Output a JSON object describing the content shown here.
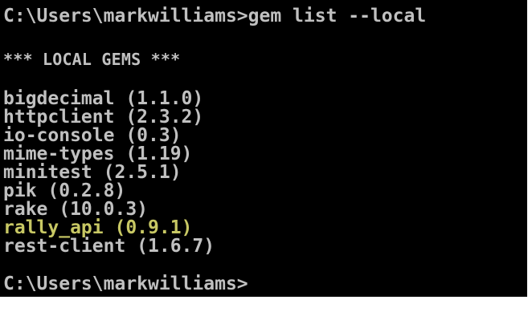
{
  "window": {
    "background": "#000000",
    "text_color": "#c0c0c0",
    "highlight_color": "#c8c864"
  },
  "terminal": {
    "command_line": "C:\\Users\\markwilliams>gem list --local",
    "header": "*** LOCAL GEMS ***",
    "gems": [
      "bigdecimal (1.1.0)",
      "httpclient (2.3.2)",
      "io-console (0.3)",
      "mime-types (1.19)",
      "minitest (2.5.1)",
      "pik (0.2.8)",
      "rake (10.0.3)",
      "rally_api (0.9.1)",
      "rest-client (1.6.7)"
    ],
    "highlighted_gem_index": 7,
    "prompt": "C:\\Users\\markwilliams>"
  }
}
